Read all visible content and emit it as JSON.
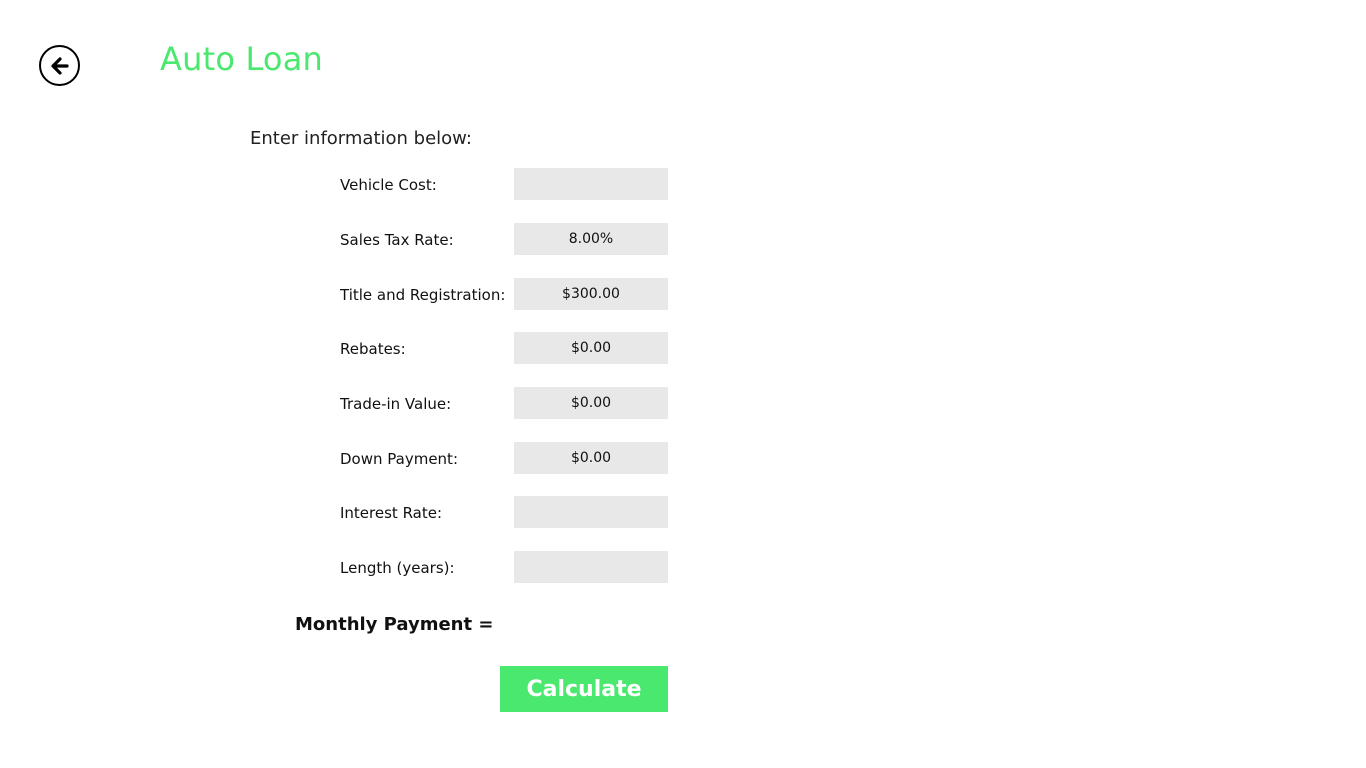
{
  "colors": {
    "accent": "#4ae86e",
    "input_background": "#e8e8e8",
    "text": "#111111"
  },
  "header": {
    "back_icon": "arrow-left-circle-icon",
    "title": "Auto Loan"
  },
  "form": {
    "intro": "Enter information below:",
    "fields": [
      {
        "label": "Vehicle Cost:",
        "value": ""
      },
      {
        "label": "Sales Tax Rate:",
        "value": "8.00%"
      },
      {
        "label": "Title and Registration:",
        "value": "$300.00"
      },
      {
        "label": "Rebates:",
        "value": "$0.00"
      },
      {
        "label": "Trade-in Value:",
        "value": "$0.00"
      },
      {
        "label": "Down Payment:",
        "value": "$0.00"
      },
      {
        "label": "Interest Rate:",
        "value": ""
      },
      {
        "label": "Length (years):",
        "value": ""
      }
    ]
  },
  "result": {
    "label": "Monthly Payment ="
  },
  "actions": {
    "calculate_label": "Calculate"
  }
}
